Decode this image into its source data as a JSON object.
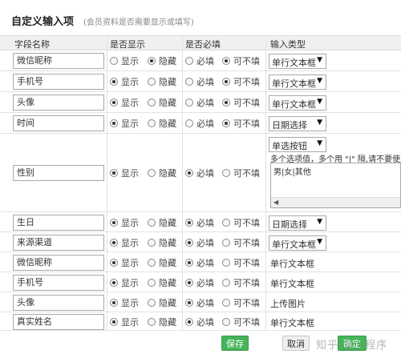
{
  "heading": {
    "title": "自定义输入项",
    "subtitle": "(会员资料是否需要显示或填写)"
  },
  "columns": {
    "field_name": "字段名称",
    "visible": "是否显示",
    "required": "是否必填",
    "input_type": "输入类型"
  },
  "labels": {
    "show": "显示",
    "hide": "隐藏",
    "required": "必填",
    "optional": "可不填"
  },
  "rows": [
    {
      "name": "微信昵称",
      "visible": "hide",
      "required": "optional",
      "type": "单行文本框",
      "editable": true
    },
    {
      "name": "手机号",
      "visible": "show",
      "required": "optional",
      "type": "单行文本框",
      "editable": true
    },
    {
      "name": "头像",
      "visible": "show",
      "required": "optional",
      "type": "单行文本框",
      "editable": true
    },
    {
      "name": "时间",
      "visible": "show",
      "required": "optional",
      "type": "日期选择",
      "editable": true
    },
    {
      "name": "性别",
      "visible": "show",
      "required": "required",
      "type": "单选按钮",
      "editable": true,
      "hint": "多个选项值，多个用 \"|\" 隔,请不要使用",
      "options_value": "男|女|其他"
    },
    {
      "name": "生日",
      "visible": "show",
      "required": "required",
      "type": "日期选择",
      "editable": true
    },
    {
      "name": "来源渠道",
      "visible": "show",
      "required": "required",
      "type": "单行文本框",
      "editable": true
    },
    {
      "name": "微信昵称",
      "visible": "show",
      "required": "required",
      "type": "单行文本框",
      "editable": false
    },
    {
      "name": "手机号",
      "visible": "show",
      "required": "required",
      "type": "单行文本框",
      "editable": false
    },
    {
      "name": "头像",
      "visible": "show",
      "required": "required",
      "type": "上传图片",
      "editable": false
    },
    {
      "name": "真实姓名",
      "visible": "show",
      "required": "required",
      "type": "单行文本框",
      "editable": false
    }
  ],
  "buttons": {
    "save": "保存",
    "cancel": "取消",
    "other": "确定"
  },
  "watermark": "知乎 @小程序",
  "colors": {
    "accent": "#46b45a",
    "header_bg": "#f0f0f0"
  }
}
